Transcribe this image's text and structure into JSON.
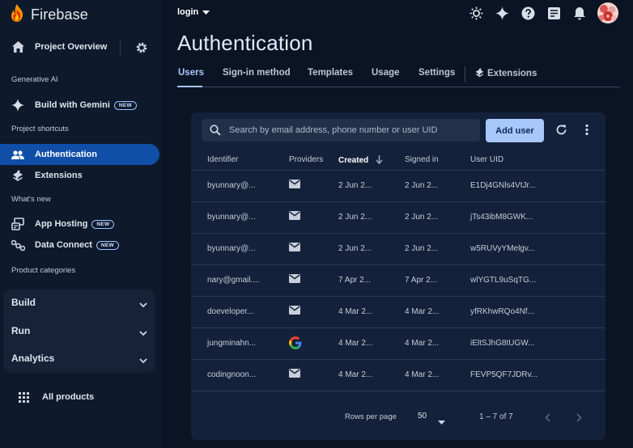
{
  "sidebar": {
    "brand": "Firebase",
    "project_overview": "Project Overview",
    "sections": {
      "generative_ai": "Generative AI",
      "project_shortcuts": "Project shortcuts",
      "whats_new": "What's new",
      "product_categories": "Product categories"
    },
    "build_with_gemini": {
      "label": "Build with Gemini",
      "badge": "NEW"
    },
    "shortcuts": [
      {
        "label": "Authentication",
        "icon": "people-icon",
        "active": true
      },
      {
        "label": "Extensions",
        "icon": "extensions-icon",
        "active": false
      }
    ],
    "whats_new_items": [
      {
        "label": "App Hosting",
        "badge": "NEW",
        "icon": "app-hosting-icon"
      },
      {
        "label": "Data Connect",
        "badge": "NEW",
        "icon": "data-connect-icon"
      }
    ],
    "categories": [
      "Build",
      "Run",
      "Analytics"
    ],
    "all_products": "All products"
  },
  "header": {
    "project": "login",
    "icons": [
      "brightness-icon",
      "gemini-sparkle-icon",
      "help-icon",
      "feedback-icon",
      "notifications-icon",
      "avatar"
    ]
  },
  "page": {
    "title": "Authentication",
    "tabs": [
      "Users",
      "Sign-in method",
      "Templates",
      "Usage",
      "Settings",
      "Extensions"
    ],
    "active_tab": "Users"
  },
  "users_table": {
    "search_placeholder": "Search by email address, phone number or user UID",
    "add_user_label": "Add user",
    "columns": [
      "Identifier",
      "Providers",
      "Created",
      "Signed in",
      "User UID"
    ],
    "sort_column": "Created",
    "rows": [
      {
        "identifier": "byunnary@...",
        "provider": "email",
        "created": "2 Jun 2...",
        "signed_in": "2 Jun 2...",
        "uid": "E1Dj4GNls4VtJr..."
      },
      {
        "identifier": "byunnary@...",
        "provider": "email",
        "created": "2 Jun 2...",
        "signed_in": "2 Jun 2...",
        "uid": "jTs43ibM8GWK..."
      },
      {
        "identifier": "byunnary@...",
        "provider": "email",
        "created": "2 Jun 2...",
        "signed_in": "2 Jun 2...",
        "uid": "w5RUVyYMelgv..."
      },
      {
        "identifier": "nary@gmail....",
        "provider": "email",
        "created": "7 Apr 2...",
        "signed_in": "7 Apr 2...",
        "uid": "wlYGTL9uSqTG..."
      },
      {
        "identifier": "doeveloper...",
        "provider": "email",
        "created": "4 Mar 2...",
        "signed_in": "4 Mar 2...",
        "uid": "yfRKhwRQo4Nf..."
      },
      {
        "identifier": "jungminahn...",
        "provider": "google",
        "created": "4 Mar 2...",
        "signed_in": "4 Mar 2...",
        "uid": "iEltSJhG8tUGW..."
      },
      {
        "identifier": "codingnoon...",
        "provider": "email",
        "created": "4 Mar 2...",
        "signed_in": "4 Mar 2...",
        "uid": "FEVP5QF7JDRv..."
      }
    ],
    "footer": {
      "rows_per_page_label": "Rows per page",
      "rows_per_page_value": "50",
      "range": "1 – 7 of 7"
    }
  }
}
